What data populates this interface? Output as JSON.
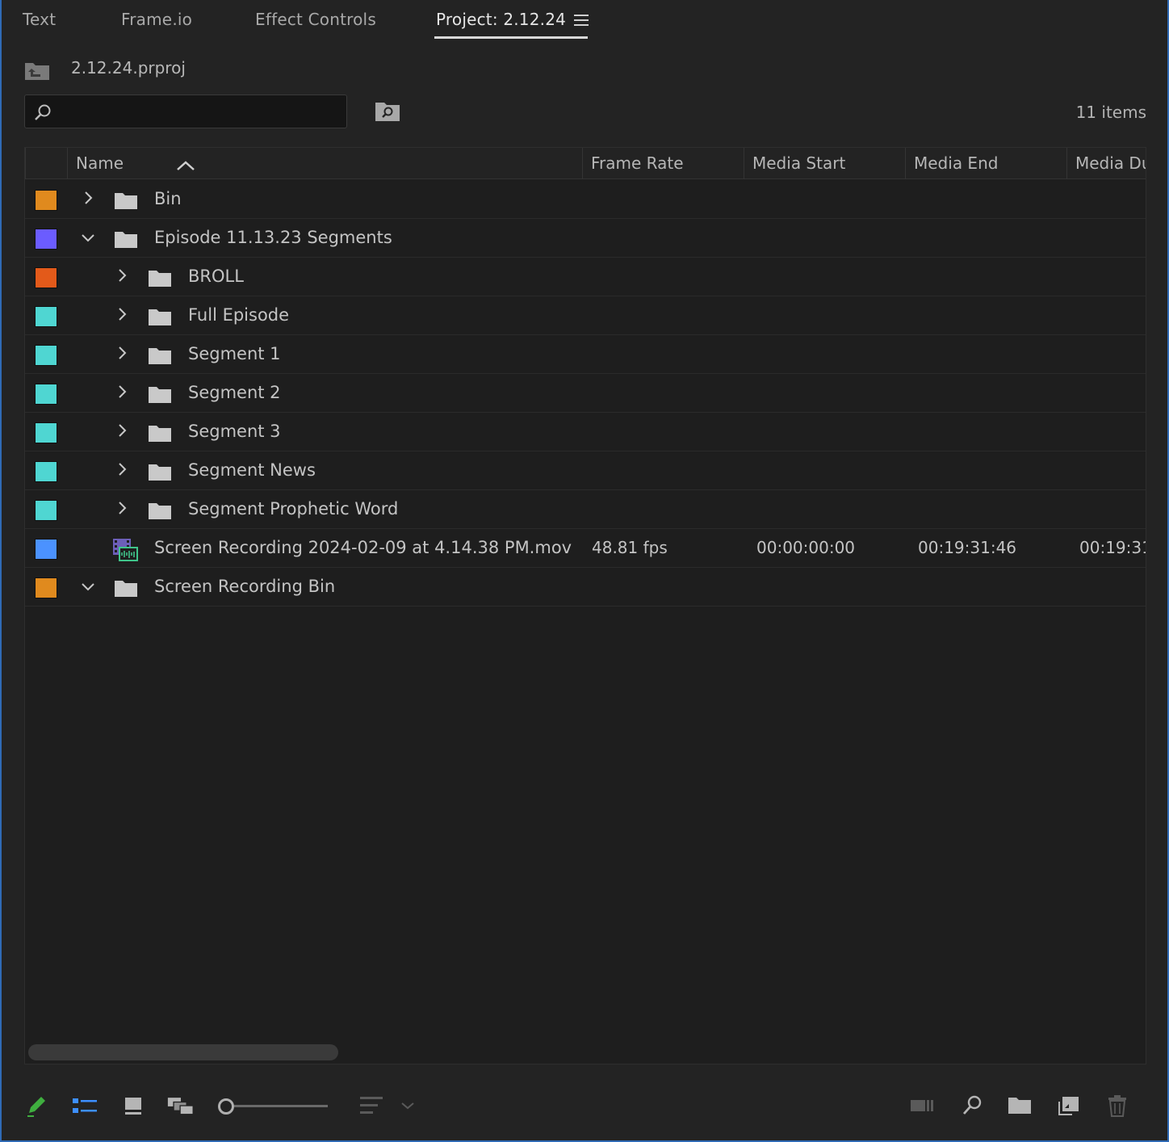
{
  "tabs": [
    {
      "label": "Text"
    },
    {
      "label": "Frame.io"
    },
    {
      "label": "Effect Controls"
    },
    {
      "label": "Project: 2.12.24",
      "active": true
    }
  ],
  "project": {
    "file_name": "2.12.24.prproj"
  },
  "search": {
    "value": "",
    "placeholder": ""
  },
  "item_count": "11 items",
  "columns": [
    {
      "label": "Name",
      "sort": "ascending"
    },
    {
      "label": "Frame Rate"
    },
    {
      "label": "Media Start"
    },
    {
      "label": "Media End"
    },
    {
      "label": "Media Du"
    }
  ],
  "rows": [
    {
      "label_color": "#e08a1e",
      "indent": 0,
      "type": "bin",
      "expanded": false,
      "name": "Bin",
      "frame_rate": "",
      "media_start": "",
      "media_end": "",
      "media_duration": ""
    },
    {
      "label_color": "#6b5cff",
      "indent": 0,
      "type": "bin",
      "expanded": true,
      "name": "Episode 11.13.23 Segments",
      "frame_rate": "",
      "media_start": "",
      "media_end": "",
      "media_duration": ""
    },
    {
      "label_color": "#e35a1a",
      "indent": 1,
      "type": "bin",
      "expanded": false,
      "name": "BROLL",
      "frame_rate": "",
      "media_start": "",
      "media_end": "",
      "media_duration": ""
    },
    {
      "label_color": "#4fd6d2",
      "indent": 1,
      "type": "bin",
      "expanded": false,
      "name": "Full Episode",
      "frame_rate": "",
      "media_start": "",
      "media_end": "",
      "media_duration": ""
    },
    {
      "label_color": "#4fd6d2",
      "indent": 1,
      "type": "bin",
      "expanded": false,
      "name": "Segment 1",
      "frame_rate": "",
      "media_start": "",
      "media_end": "",
      "media_duration": ""
    },
    {
      "label_color": "#4fd6d2",
      "indent": 1,
      "type": "bin",
      "expanded": false,
      "name": "Segment 2",
      "frame_rate": "",
      "media_start": "",
      "media_end": "",
      "media_duration": ""
    },
    {
      "label_color": "#4fd6d2",
      "indent": 1,
      "type": "bin",
      "expanded": false,
      "name": "Segment 3",
      "frame_rate": "",
      "media_start": "",
      "media_end": "",
      "media_duration": ""
    },
    {
      "label_color": "#4fd6d2",
      "indent": 1,
      "type": "bin",
      "expanded": false,
      "name": "Segment News",
      "frame_rate": "",
      "media_start": "",
      "media_end": "",
      "media_duration": ""
    },
    {
      "label_color": "#4fd6d2",
      "indent": 1,
      "type": "bin",
      "expanded": false,
      "name": "Segment Prophetic Word",
      "frame_rate": "",
      "media_start": "",
      "media_end": "",
      "media_duration": ""
    },
    {
      "label_color": "#4b92ff",
      "indent": 0,
      "type": "clip",
      "expanded": null,
      "name": "Screen Recording 2024-02-09 at 4.14.38 PM.mov",
      "frame_rate": "48.81 fps",
      "media_start": "00:00:00:00",
      "media_end": "00:19:31:46",
      "media_duration": "00:19:31"
    },
    {
      "label_color": "#e08a1e",
      "indent": 0,
      "type": "bin",
      "expanded": true,
      "name": "Screen Recording Bin",
      "frame_rate": "",
      "media_start": "",
      "media_end": "",
      "media_duration": ""
    }
  ],
  "toolbar": {
    "icons": [
      "pencil-icon",
      "list-view-icon",
      "icon-view-icon",
      "freeform-view-icon",
      "zoom-slider",
      "sort-icons-icon",
      "automate-to-sequence-icon",
      "find-icon",
      "new-bin-icon",
      "new-item-icon",
      "clear-icon"
    ],
    "zoom_level": 0.0
  },
  "colors": {
    "accent": "#2f6ab5",
    "panel_bg": "#232323",
    "table_bg": "#1e1e1e"
  }
}
